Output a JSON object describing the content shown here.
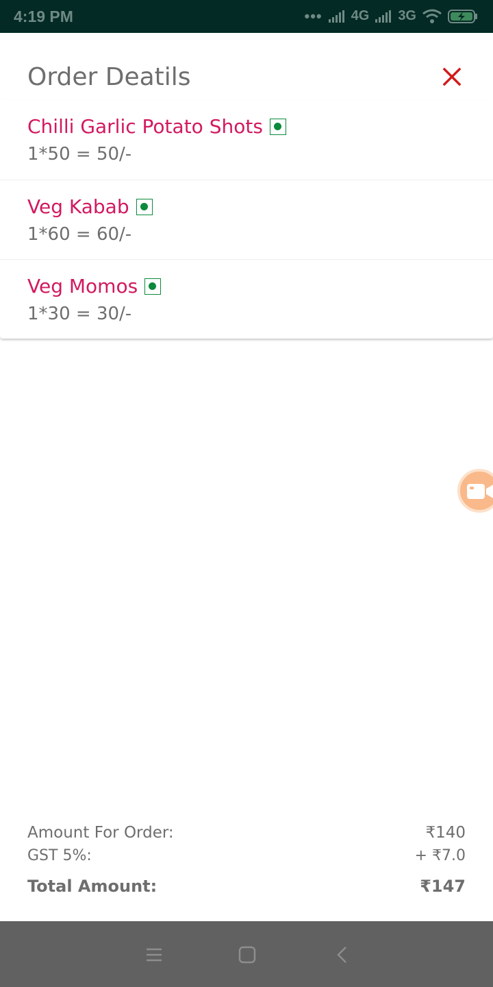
{
  "status_bar": {
    "time": "4:19 PM",
    "network1": "4G",
    "network2": "3G",
    "icons": [
      "signal-dots-icon",
      "signal-bars-icon",
      "wifi-icon",
      "battery-charging-icon"
    ]
  },
  "header": {
    "title": "Order Deatils",
    "close_icon": "close-icon",
    "close_color": "#d11a1a"
  },
  "items": [
    {
      "name": "Chilli Garlic Potato Shots",
      "price_line": "1*50 = 50/-"
    },
    {
      "name": "Veg Kabab",
      "price_line": "1*60 = 60/-"
    },
    {
      "name": "Veg Momos",
      "price_line": "1*30 = 30/-"
    }
  ],
  "veg_indicator_color": "#0b8a3b",
  "item_name_color": "#d2195f",
  "summary": {
    "amount_label": "Amount For Order:",
    "amount_value": "₹140",
    "gst_label": "GST 5%:",
    "gst_value": "+ ₹7.0",
    "total_label": "Total Amount:",
    "total_value": "₹147"
  },
  "floating_button": {
    "icon": "video-camera-icon",
    "color": "#f9b98a"
  },
  "nav_bar": {
    "icons": [
      "menu-icon",
      "home-square-icon",
      "back-icon"
    ]
  }
}
